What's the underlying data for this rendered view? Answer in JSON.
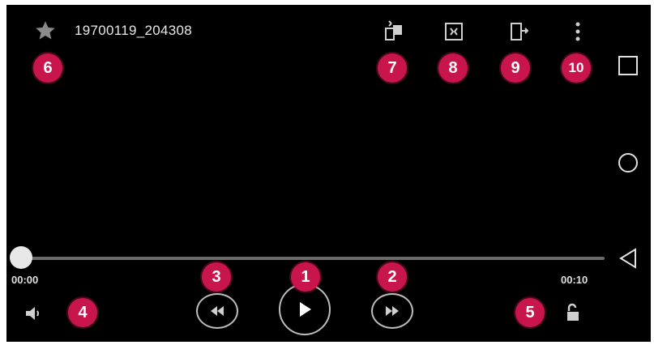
{
  "header": {
    "title": "19700119_204308",
    "favorite_icon": "star-icon",
    "actions": [
      {
        "icon": "rotate-screen-icon",
        "badge": "7"
      },
      {
        "icon": "zoom-fit-icon",
        "badge": "8"
      },
      {
        "icon": "share-screen-icon",
        "badge": "9"
      },
      {
        "icon": "more-options-icon",
        "badge": "10"
      }
    ],
    "favorite_badge": "6"
  },
  "playback": {
    "current_time": "00:00",
    "total_time": "00:10",
    "progress_fraction": 0.0
  },
  "controls": {
    "play_badge": "1",
    "forward_badge": "2",
    "rewind_badge": "3",
    "volume_badge": "4",
    "lock_badge": "5"
  },
  "colors": {
    "badge": "#c8164c",
    "background": "#000000",
    "icon": "#cfcfcf"
  }
}
